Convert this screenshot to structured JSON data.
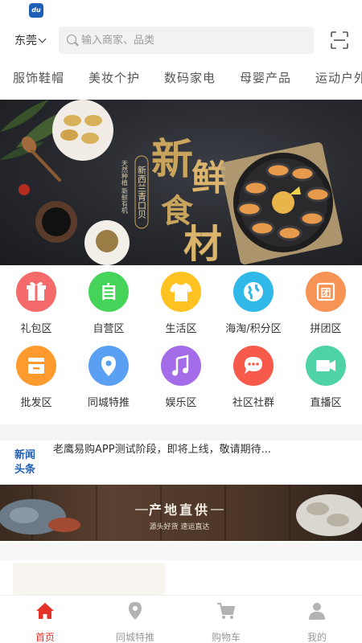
{
  "app": {
    "logo_text": "du"
  },
  "header": {
    "city": "东莞",
    "search_placeholder": "输入商家、品类"
  },
  "category_tabs": [
    "服饰鞋帽",
    "美妆个护",
    "数码家电",
    "母婴产品",
    "运动户外"
  ],
  "banner": {
    "headline_chars": [
      "新",
      "鲜",
      "食",
      "材"
    ],
    "vertical_text": "新西兰青口贝",
    "side_text": "天然种植 新鲜有机",
    "colors": {
      "gold": "#c9a45c",
      "dark": "#26282d"
    }
  },
  "grid_items": [
    {
      "label": "礼包区",
      "icon": "gift-icon",
      "color": "#f56a6a",
      "glyph": "🎁"
    },
    {
      "label": "自营区",
      "icon": "self-run-icon",
      "color": "#46d35a",
      "glyph": "自"
    },
    {
      "label": "生活区",
      "icon": "shirt-icon",
      "color": "#ffc321",
      "glyph": "👕"
    },
    {
      "label": "海淘/积分区",
      "icon": "globe-icon",
      "color": "#2fb8e8",
      "glyph": "🌍"
    },
    {
      "label": "拼团区",
      "icon": "group-buy-icon",
      "color": "#f79355",
      "glyph": "团"
    },
    {
      "label": "批发区",
      "icon": "wholesale-box-icon",
      "color": "#ff9b2e",
      "glyph": "▤"
    },
    {
      "label": "同城特推",
      "icon": "location-pin-icon",
      "color": "#5aa0f2",
      "glyph": "⌖"
    },
    {
      "label": "娱乐区",
      "icon": "music-note-icon",
      "color": "#a46ce8",
      "glyph": "♫"
    },
    {
      "label": "社区社群",
      "icon": "chat-bubble-icon",
      "color": "#f7594a",
      "glyph": "…"
    },
    {
      "label": "直播区",
      "icon": "video-camera-icon",
      "color": "#4fd3a6",
      "glyph": "▶"
    }
  ],
  "news": {
    "badge_line1": "新闻",
    "badge_line2": "头条",
    "text": "老鹰易购APP测试阶段，即将上线，敬请期待..."
  },
  "promo": {
    "title": "产地直供",
    "subtitle": "源头好货 速运直达"
  },
  "bottom_nav": [
    {
      "label": "首页",
      "icon": "home-icon",
      "active": true
    },
    {
      "label": "同城特推",
      "icon": "location-icon",
      "active": false
    },
    {
      "label": "购物车",
      "icon": "cart-icon",
      "active": false
    },
    {
      "label": "我的",
      "icon": "user-icon",
      "active": false
    }
  ],
  "accent_color": "#e6332a"
}
